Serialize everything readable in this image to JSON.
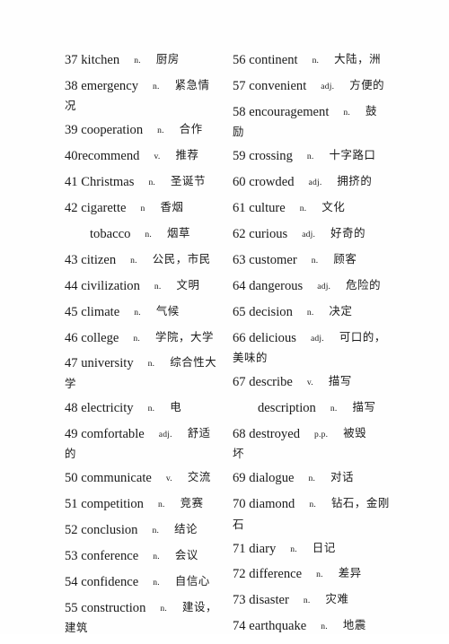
{
  "document": {
    "type": "vocabulary-list",
    "language_pair": "English-Chinese",
    "columns": 2,
    "number_range": "37-74",
    "text_color": "#1a1a1a",
    "background_color": "#ffffff"
  },
  "left_column": [
    {
      "num": "37",
      "word": "kitchen",
      "pos": "n.",
      "cn": "厨房",
      "cn_wrap": ""
    },
    {
      "num": "38",
      "word": "emergency",
      "pos": "n.",
      "cn": "紧急情",
      "cn_wrap": "况"
    },
    {
      "num": "39",
      "word": "cooperation",
      "pos": "n.",
      "cn": "合作",
      "cn_wrap": ""
    },
    {
      "num": "40",
      "word": "recommend",
      "pos": "v.",
      "cn": "推荐",
      "cn_wrap": "",
      "no_space_after_num": true
    },
    {
      "num": "41",
      "word": "Christmas",
      "pos": "n.",
      "cn": "圣诞节",
      "cn_wrap": ""
    },
    {
      "num": "42",
      "word": "cigarette",
      "pos": "n",
      "cn": "香烟",
      "cn_wrap": ""
    },
    {
      "num": "",
      "word": "tobacco",
      "pos": "n.",
      "cn": "烟草",
      "cn_wrap": "",
      "sub": true
    },
    {
      "num": "43",
      "word": "citizen",
      "pos": "n.",
      "cn": "公民，市民",
      "cn_wrap": ""
    },
    {
      "num": "44",
      "word": "civilization",
      "pos": "n.",
      "cn": "文明",
      "cn_wrap": ""
    },
    {
      "num": "45",
      "word": "climate",
      "pos": "n.",
      "cn": "气候",
      "cn_wrap": ""
    },
    {
      "num": "46",
      "word": "college",
      "pos": "n.",
      "cn": "学院，大学",
      "cn_wrap": ""
    },
    {
      "num": "47",
      "word": "university",
      "pos": "n.",
      "cn": "综合性大",
      "cn_wrap": "学"
    },
    {
      "num": "48",
      "word": "electricity",
      "pos": "n.",
      "cn": "电",
      "cn_wrap": ""
    },
    {
      "num": "49",
      "word": "comfortable",
      "pos": "adj.",
      "cn": "舒适",
      "cn_wrap": "的"
    },
    {
      "num": "50",
      "word": "communicate",
      "pos": "v.",
      "cn": "交流",
      "cn_wrap": ""
    },
    {
      "num": "51",
      "word": "competition",
      "pos": "n.",
      "cn": "竞赛",
      "cn_wrap": ""
    },
    {
      "num": "52",
      "word": "conclusion",
      "pos": "n.",
      "cn": "结论",
      "cn_wrap": ""
    },
    {
      "num": "53",
      "word": "conference",
      "pos": "n.",
      "cn": "会议",
      "cn_wrap": ""
    },
    {
      "num": "54",
      "word": "confidence",
      "pos": "n.",
      "cn": "自信心",
      "cn_wrap": ""
    },
    {
      "num": "55",
      "word": "construction",
      "pos": "n.",
      "cn": "建设，",
      "cn_wrap": "建筑"
    }
  ],
  "right_column": [
    {
      "num": "56",
      "word": "continent",
      "pos": "n.",
      "cn": "大陆，洲",
      "cn_wrap": ""
    },
    {
      "num": "57",
      "word": "convenient",
      "pos": "adj.",
      "cn": "方便的",
      "cn_wrap": ""
    },
    {
      "num": "58",
      "word": "encouragement",
      "pos": "n.",
      "cn": "鼓",
      "cn_wrap": "励"
    },
    {
      "num": "59",
      "word": "crossing",
      "pos": "n.",
      "cn": "十字路口",
      "cn_wrap": ""
    },
    {
      "num": "60",
      "word": "crowded",
      "pos": "adj.",
      "cn": "拥挤的",
      "cn_wrap": ""
    },
    {
      "num": "61",
      "word": "culture",
      "pos": "n.",
      "cn": "文化",
      "cn_wrap": ""
    },
    {
      "num": "62",
      "word": "curious",
      "pos": "adj.",
      "cn": "好奇的",
      "cn_wrap": ""
    },
    {
      "num": "63",
      "word": "customer",
      "pos": "n.",
      "cn": "顾客",
      "cn_wrap": ""
    },
    {
      "num": "64",
      "word": "dangerous",
      "pos": "adj.",
      "cn": "危险的",
      "cn_wrap": ""
    },
    {
      "num": "65",
      "word": "decision",
      "pos": "n.",
      "cn": "决定",
      "cn_wrap": ""
    },
    {
      "num": "66",
      "word": "delicious",
      "pos": "adj.",
      "cn": "可口的，",
      "cn_wrap": "美味的"
    },
    {
      "num": "67",
      "word": "describe",
      "pos": "v.",
      "cn": "描写",
      "cn_wrap": ""
    },
    {
      "num": "",
      "word": "description",
      "pos": "n.",
      "cn": "描写",
      "cn_wrap": "",
      "sub": true
    },
    {
      "num": "68",
      "word": "destroyed",
      "pos": "p.p.",
      "cn": "被毁",
      "cn_wrap": "坏"
    },
    {
      "num": "69",
      "word": "dialogue",
      "pos": "n.",
      "cn": "对话",
      "cn_wrap": ""
    },
    {
      "num": "70",
      "word": "diamond",
      "pos": "n.",
      "cn": "钻石，金刚",
      "cn_wrap": "石"
    },
    {
      "num": "71",
      "word": "diary",
      "pos": "n.",
      "cn": "日记",
      "cn_wrap": ""
    },
    {
      "num": "72",
      "word": "difference",
      "pos": "n.",
      "cn": "差异",
      "cn_wrap": ""
    },
    {
      "num": "73",
      "word": "disaster",
      "pos": "n.",
      "cn": "灾难",
      "cn_wrap": ""
    },
    {
      "num": "74",
      "word": "earthquake",
      "pos": "n.",
      "cn": "地震",
      "cn_wrap": ""
    }
  ]
}
